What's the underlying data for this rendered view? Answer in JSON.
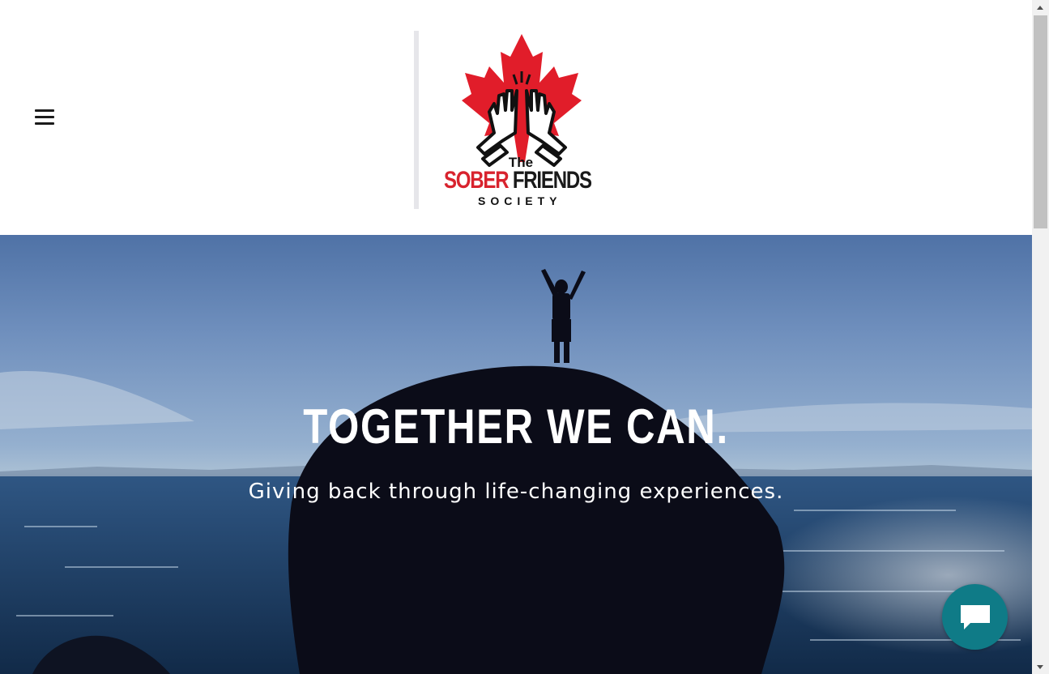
{
  "header": {
    "menu_icon": "hamburger-menu-icon",
    "logo": {
      "line1": "The",
      "line2_red": "SOBER",
      "line2_dark": "FRIENDS",
      "line3": "SOCIETY",
      "icon": "maple-leaf-high-five-icon",
      "colors": {
        "maple_red": "#e11d2a",
        "sober_red": "#d8232e",
        "dark": "#1a1a1a"
      }
    }
  },
  "hero": {
    "title": "TOGETHER WE CAN.",
    "subtitle": "Giving back through life-changing experiences."
  },
  "chat": {
    "icon": "chat-bubble-icon",
    "color": "#0f7b87"
  },
  "scrollbar": {
    "icons": [
      "arrow-up-icon",
      "arrow-down-icon"
    ]
  }
}
